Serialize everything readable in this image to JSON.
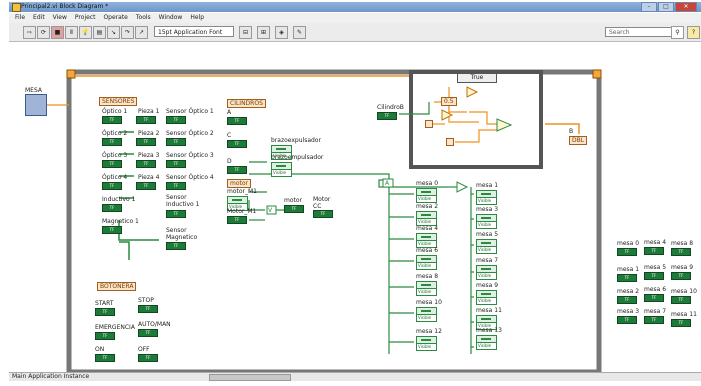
{
  "window": {
    "title": "Principal2.vi Block Diagram *"
  },
  "menu": [
    "File",
    "Edit",
    "View",
    "Project",
    "Operate",
    "Tools",
    "Window",
    "Help"
  ],
  "toolbar": {
    "font": "15pt Application Font",
    "search_placeholder": "Search"
  },
  "status": {
    "label": "Main Application Instance"
  },
  "mesa_label": "MESA",
  "groups": {
    "sensores": "SENSORES",
    "cilindros": "CILINDROS",
    "botonera": "BOTONERA"
  },
  "tf_text": "TF",
  "visible_text": "Visible",
  "sensores_left": [
    "Óptico 1",
    "Óptico 2",
    "Óptico 3",
    "Óptico 4",
    "Inductivo 1",
    "Magnetico 1"
  ],
  "piezas": [
    "Pieza 1",
    "Pieza 2",
    "Pieza 3",
    "Pieza 4"
  ],
  "sensores_right": [
    "Sensor Óptico 1",
    "Sensor Óptico 2",
    "Sensor Óptico 3",
    "Sensor Óptico 4",
    "Sensor Inductivo 1",
    "Sensor Magnetico"
  ],
  "cilindros": [
    "A",
    "C",
    "D"
  ],
  "brazo": [
    "brazoexpulsador",
    "brazoempulsador"
  ],
  "motor_items": [
    "motor",
    "motor_M1",
    "Motor_M1",
    "motor",
    "Motor CC"
  ],
  "cilindro_b": "CilindroB",
  "case_label": "True",
  "const_05": "0.5",
  "b_label": "B",
  "b_value": "DBL",
  "botonera": [
    "START",
    "STOP",
    "EMERGENCIA",
    "AUTO/MAN",
    "ON",
    "OFF"
  ],
  "mesa_col1": [
    "mesa 0",
    "mesa 2",
    "mesa 4",
    "mesa 6",
    "mesa 8",
    "mesa 10",
    "mesa 12"
  ],
  "mesa_col2": [
    "mesa 1",
    "mesa 3",
    "mesa 5",
    "mesa 7",
    "mesa 9",
    "mesa 11",
    "mesa 13"
  ],
  "mesa_grid": [
    "mesa 0",
    "mesa 4",
    "mesa 8",
    "mesa 1",
    "mesa 5",
    "mesa 9",
    "mesa 2",
    "mesa 6",
    "mesa 10",
    "mesa 3",
    "mesa 7",
    "mesa 11"
  ]
}
